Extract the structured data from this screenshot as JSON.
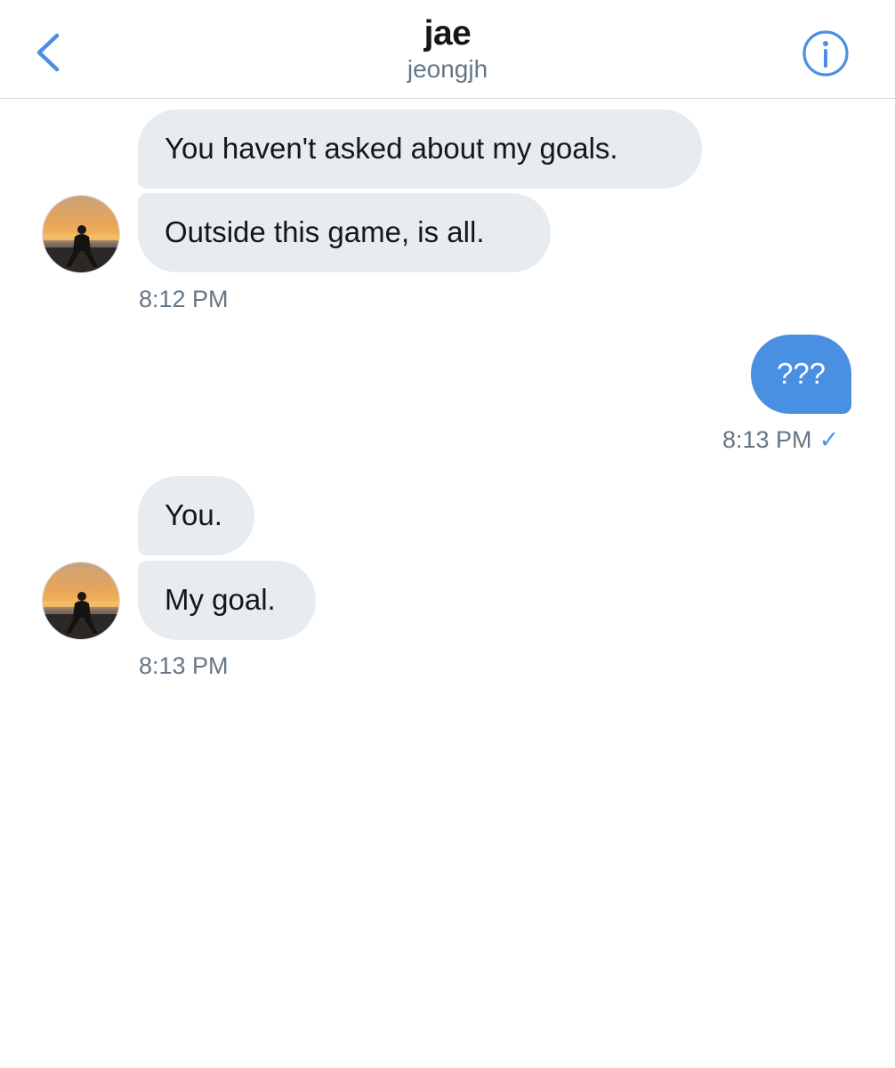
{
  "header": {
    "title": "jae",
    "subtitle": "jeongjh",
    "back_icon": "chevron-left-icon",
    "info_icon": "info-icon"
  },
  "colors": {
    "accent": "#4a90e2",
    "incoming_bubble": "#e6ecf0",
    "muted_text": "#657786"
  },
  "messages": [
    {
      "direction": "incoming",
      "text": "You haven't asked about my goals."
    },
    {
      "direction": "incoming",
      "text": "Outside this game, is all."
    },
    {
      "direction": "outgoing",
      "text": "???"
    },
    {
      "direction": "incoming",
      "text": "You."
    },
    {
      "direction": "incoming",
      "text": "My goal."
    }
  ],
  "timestamps": {
    "group1": "8:12 PM",
    "group2": "8:13 PM",
    "group3": "8:13 PM"
  },
  "read_receipt": "✓"
}
